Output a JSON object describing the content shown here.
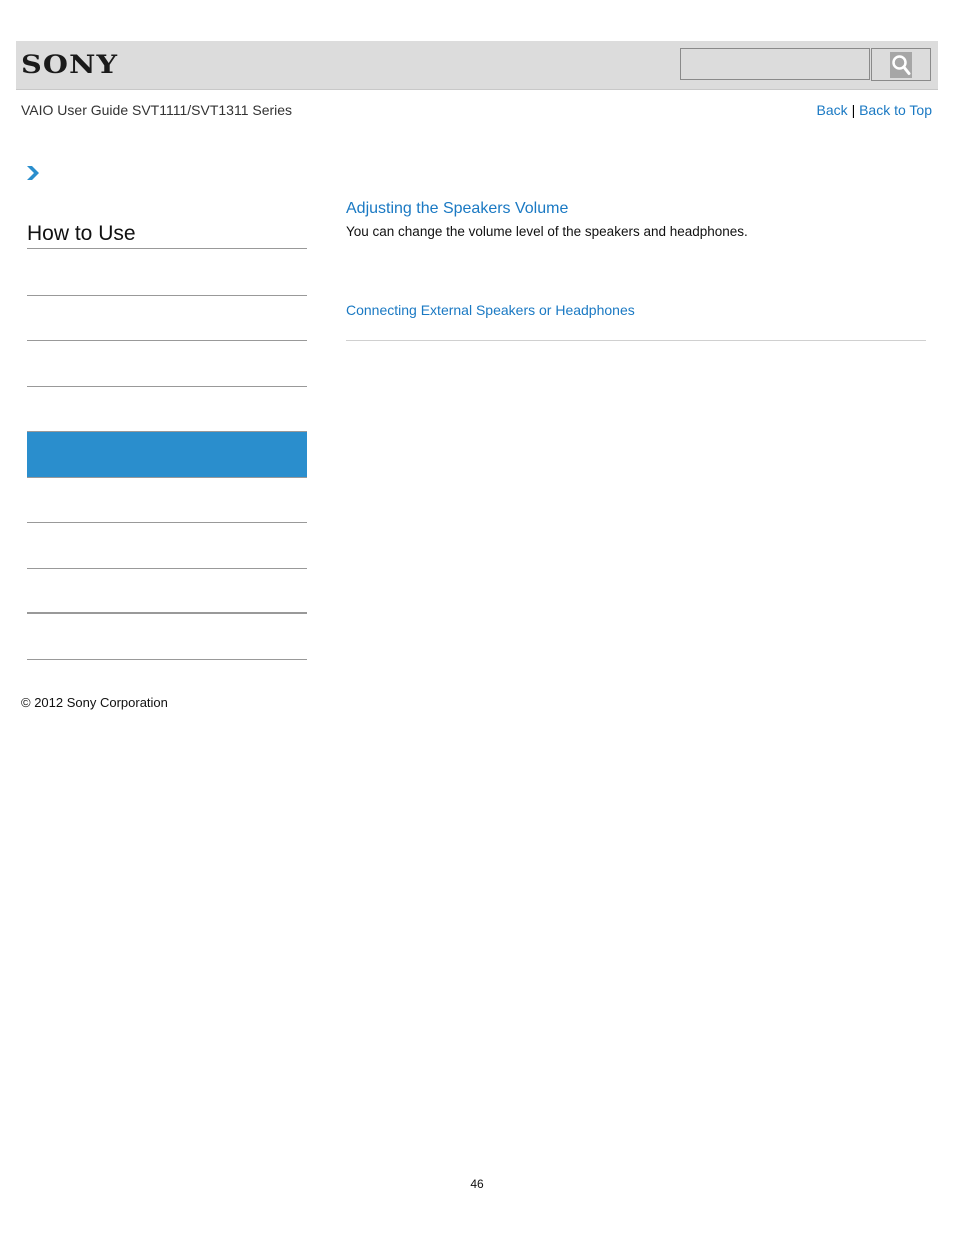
{
  "header": {
    "logo_text": "SONY",
    "search": {
      "placeholder": "",
      "value": ""
    },
    "search_button_icon": "magnifier-icon"
  },
  "guide_title": "VAIO User Guide SVT1111/SVT1311 Series",
  "nav_links": {
    "back": "Back",
    "separator": "|",
    "back_to_top": "Back to Top"
  },
  "breadcrumb_icon": "chevron-right-icon",
  "sidebar": {
    "heading": "How to Use",
    "items": [
      {
        "label": "",
        "active": false
      },
      {
        "label": "",
        "active": false
      },
      {
        "label": "",
        "active": false
      },
      {
        "label": "",
        "active": true
      },
      {
        "label": "",
        "active": false
      },
      {
        "label": "",
        "active": false
      },
      {
        "label": "",
        "active": false
      },
      {
        "label": "",
        "active": false
      }
    ]
  },
  "main": {
    "article_title": "Adjusting the Speakers Volume",
    "article_description": "You can change the volume level of the speakers and headphones.",
    "related_link": "Connecting External Speakers or Headphones"
  },
  "footer": {
    "copyright": "© 2012 Sony Corporation",
    "page_number": "46"
  },
  "colors": {
    "link": "#1a79c3",
    "active_item": "#2a8ecd",
    "header_bg": "#dcdcdc"
  }
}
